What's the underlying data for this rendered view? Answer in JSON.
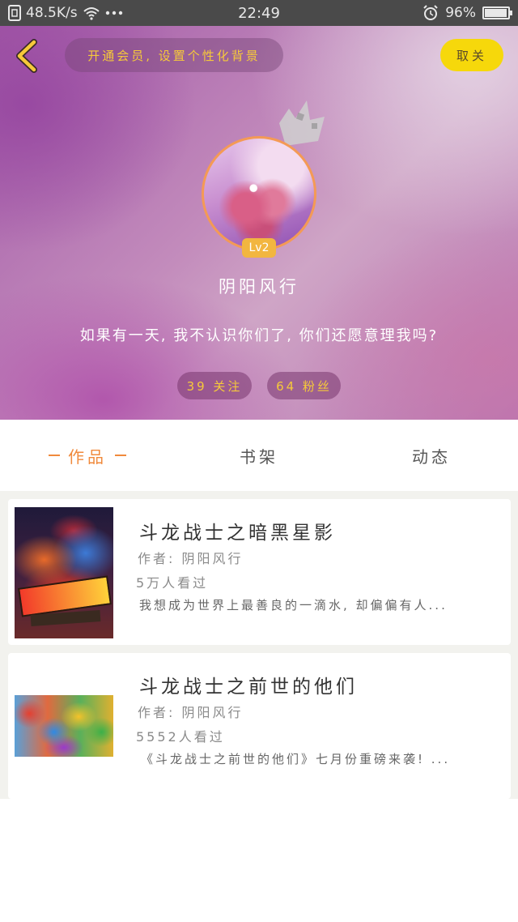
{
  "status_bar": {
    "net_speed": "48.5K/s",
    "time": "22:49",
    "battery": "96%",
    "battery_level": 0.96
  },
  "header": {
    "vip_banner": "开通会员, 设置个性化背景",
    "cancel_label": "取关"
  },
  "profile": {
    "level": "Lv2",
    "username": "阴阳风行",
    "bio": "如果有一天, 我不认识你们了, 你们还愿意理我吗?",
    "following": "39 关注",
    "fans": "64 粉丝"
  },
  "tabs": [
    {
      "label": "作品",
      "active": true
    },
    {
      "label": "书架",
      "active": false
    },
    {
      "label": "动态",
      "active": false
    }
  ],
  "books": [
    {
      "title": "斗龙战士之暗黑星影",
      "author": "作者: 阴阳风行",
      "views": "5万人看过",
      "description": "我想成为世界上最善良的一滴水, 却偏偏有人..."
    },
    {
      "title": "斗龙战士之前世的他们",
      "author": "作者: 阴阳风行",
      "views": "5552人看过",
      "description": "《斗龙战士之前世的他们》七月份重磅来袭! ..."
    }
  ],
  "colors": {
    "accent_orange": "#f08a3c",
    "vip_yellow": "#f6c93a",
    "cancel_button": "#f6d80b"
  }
}
